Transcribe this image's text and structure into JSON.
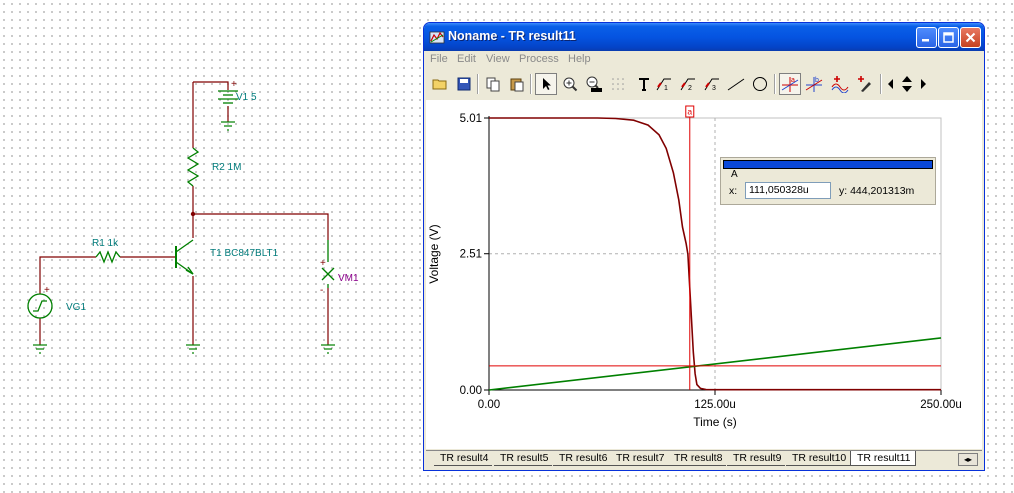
{
  "schematic": {
    "v1_label": "V1 5",
    "v1_plus": "+",
    "r2_label": "R2 1M",
    "r1_label": "R1 1k",
    "t1_label": "T1 BC847BLT1",
    "vg1_label": "VG1",
    "vg1_plus": "+",
    "vm1_label": "VM1",
    "vm1_plus": "+",
    "vm1_minus": "-"
  },
  "window": {
    "title": "Noname - TR result11",
    "menu": [
      "File",
      "Edit",
      "View",
      "Process",
      "Help"
    ],
    "toolbar_icons": [
      "open-icon",
      "save-icon",
      "copy-icon",
      "paste-icon",
      "pointer-icon",
      "zoom-in-icon",
      "zoom-100-icon",
      "grid-icon",
      "text-icon",
      "label-1-icon",
      "label-2-icon",
      "label-3-icon",
      "line-icon",
      "circle-icon",
      "cursor-a-icon",
      "cursor-b-icon",
      "add-curve-icon",
      "pen-icon",
      "left-arrow-icon",
      "updown-arrow-icon",
      "right-arrow-icon"
    ]
  },
  "cursor": {
    "name": "A",
    "marker": "a",
    "x_label": "x:",
    "x_value": "111,050328u",
    "y_text": "y: 444,201313m",
    "x": 111.05,
    "y": 0.4442
  },
  "tabs": {
    "items": [
      "TR result4",
      "TR result5",
      "TR result6",
      "TR result7",
      "TR result8",
      "TR result9",
      "TR result10",
      "TR result11"
    ],
    "active": "TR result11"
  },
  "chart_data": {
    "type": "line",
    "xlabel": "Time (s)",
    "ylabel": "Voltage (V)",
    "xlim": [
      0,
      250
    ],
    "ylim": [
      0,
      5.01
    ],
    "x_ticks": [
      "0.00",
      "125.00u",
      "250.00u"
    ],
    "x_tick_values": [
      0,
      125,
      250
    ],
    "y_ticks": [
      "0.00",
      "2.51",
      "5.01"
    ],
    "y_tick_values": [
      0,
      2.51,
      5.01
    ],
    "grid": true,
    "series": [
      {
        "color": "#800000",
        "x": [
          0,
          60,
          70,
          80,
          88,
          94,
          98,
          102,
          105,
          107,
          109,
          110,
          111,
          112,
          113,
          114,
          115,
          117,
          120,
          130,
          150,
          200,
          250
        ],
        "y": [
          5.01,
          5.01,
          5.0,
          4.97,
          4.88,
          4.7,
          4.45,
          4.0,
          3.5,
          3.0,
          2.7,
          2.5,
          1.9,
          1.3,
          0.7,
          0.3,
          0.1,
          0.03,
          0.01,
          0.005,
          0.005,
          0.005,
          0.005
        ]
      },
      {
        "color": "#008000",
        "x": [
          0,
          250
        ],
        "y": [
          0,
          0.96
        ]
      }
    ]
  }
}
